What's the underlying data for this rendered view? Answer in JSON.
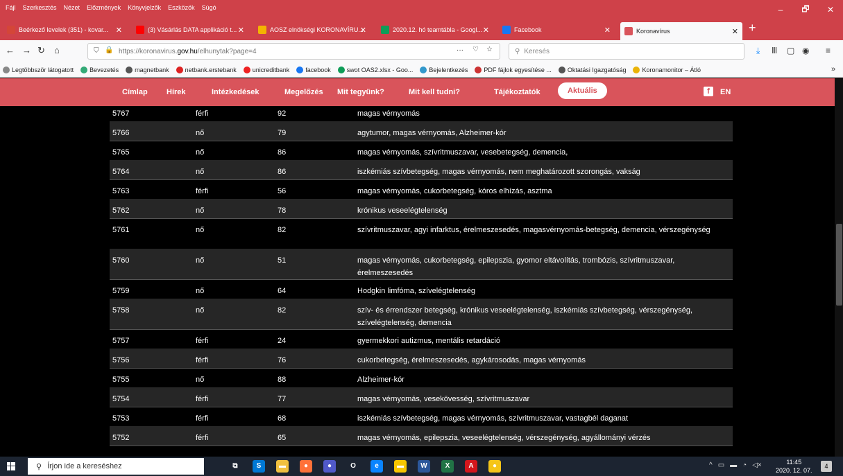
{
  "menubar": {
    "items": [
      "Fájl",
      "Szerkesztés",
      "Nézet",
      "Előzmények",
      "Könyvjelzők",
      "Eszközök",
      "Súgó"
    ]
  },
  "window": {
    "minimize": "–",
    "restore": "🗗",
    "close": "✕"
  },
  "tabs": [
    {
      "label": "Beérkező levelek (351) - kovar...",
      "icon": "gmail-icon",
      "color": "#d44638"
    },
    {
      "label": "(3) Vásárlás DATA applikáció t...",
      "icon": "youtube-icon",
      "color": "#ff0000"
    },
    {
      "label": "AOSZ elnökségi KORONAVÍRU...",
      "icon": "google-drive-icon",
      "color": "#f4b400"
    },
    {
      "label": "2020.12. hó teamtábla - Googl...",
      "icon": "google-sheets-icon",
      "color": "#0f9d58"
    },
    {
      "label": "Facebook",
      "icon": "facebook-icon",
      "color": "#1877f2"
    },
    {
      "label": "Koronavírus",
      "icon": "virus-icon",
      "color": "#d9545b",
      "active": true
    }
  ],
  "nav": {
    "url_prefix": "https://koronavirus.",
    "url_domain": "gov.hu",
    "url_suffix": "/elhunytak?page=4",
    "search_placeholder": "Keresés",
    "url_more": "···"
  },
  "bookmarks": [
    {
      "label": "Legtöbbször látogatott",
      "color": "#888"
    },
    {
      "label": "Bevezetés",
      "color": "#3a7"
    },
    {
      "label": "magnetbank",
      "color": "#555"
    },
    {
      "label": "netbank.erstebank",
      "color": "#d22"
    },
    {
      "label": "unicreditbank",
      "color": "#e22"
    },
    {
      "label": "facebook",
      "color": "#1877f2"
    },
    {
      "label": "swot OAS2.xlsx - Goo...",
      "color": "#0f9d58"
    },
    {
      "label": "Bejelentkezés",
      "color": "#39c"
    },
    {
      "label": "PDF fájlok egyesítése ...",
      "color": "#c33"
    },
    {
      "label": "Oktatási Igazgatóság",
      "color": "#555"
    },
    {
      "label": "Koronamonitor – Átló",
      "color": "#eab308"
    }
  ],
  "site_nav": {
    "items": [
      "Címlap",
      "Hírek",
      "Intézkedések",
      "Megelőzés",
      "Mit tegyünk?",
      "Mit kell tudni?",
      "Tájékoztatók",
      "Aktuális"
    ],
    "active": "Aktuális",
    "fb": "f",
    "lang": "EN"
  },
  "table": {
    "rows": [
      {
        "id": "5767",
        "sex": "férfi",
        "age": "92",
        "conditions": "magas vérnyomás"
      },
      {
        "id": "5766",
        "sex": "nő",
        "age": "79",
        "conditions": "agytumor, magas vérnyomás, Alzheimer-kór"
      },
      {
        "id": "5765",
        "sex": "nő",
        "age": "86",
        "conditions": "magas vérnyomás, szívritmuszavar, vesebetegség, demencia,"
      },
      {
        "id": "5764",
        "sex": "nő",
        "age": "86",
        "conditions": "iszkémiás szívbetegség, magas vérnyomás, nem meghatározott szorongás, vakság"
      },
      {
        "id": "5763",
        "sex": "férfi",
        "age": "56",
        "conditions": "magas vérnyomás, cukorbetegség, kóros elhízás, asztma"
      },
      {
        "id": "5762",
        "sex": "nő",
        "age": "78",
        "conditions": "krónikus veseelégtelenség"
      },
      {
        "id": "5761",
        "sex": "nő",
        "age": "82",
        "conditions": "szívritmuszavar, agyi infarktus, érelmeszesedés, magasvérnyomás-betegség, demencia, vérszegénység"
      },
      {
        "id": "5760",
        "sex": "nő",
        "age": "51",
        "conditions": "magas vérnyomás, cukorbetegség, epilepszia, gyomor eltávolítás, trombózis, szívritmuszavar, érelmeszesedés"
      },
      {
        "id": "5759",
        "sex": "nő",
        "age": "64",
        "conditions": "Hodgkin limfóma, szívelégtelenség"
      },
      {
        "id": "5758",
        "sex": "nő",
        "age": "82",
        "conditions": "szív- és érrendszer betegség, krónikus veseelégtelenség, iszkémiás szívbetegség, vérszegénység, szívelégtelenség, demencia"
      },
      {
        "id": "5757",
        "sex": "férfi",
        "age": "24",
        "conditions": "gyermekkori autizmus, mentális retardáció"
      },
      {
        "id": "5756",
        "sex": "férfi",
        "age": "76",
        "conditions": "cukorbetegség, érelmeszesedés, agykárosodás, magas vérnyomás"
      },
      {
        "id": "5755",
        "sex": "nő",
        "age": "88",
        "conditions": "Alzheimer-kór"
      },
      {
        "id": "5754",
        "sex": "férfi",
        "age": "77",
        "conditions": "magas vérnyomás, vesekövesség, szívritmuszavar"
      },
      {
        "id": "5753",
        "sex": "férfi",
        "age": "68",
        "conditions": "iszkémiás szívbetegség, magas vérnyomás, szívritmuszavar, vastagbél daganat"
      },
      {
        "id": "5752",
        "sex": "férfi",
        "age": "65",
        "conditions": "magas vérnyomás, epilepszia, veseelégtelenség, vérszegénység, agyállományi vérzés"
      }
    ]
  },
  "taskbar": {
    "search_placeholder": "Írjon ide a kereséshez",
    "apps": [
      {
        "icon": "task-view-icon",
        "label": "⧉",
        "color": "#1c2431"
      },
      {
        "icon": "skype-icon",
        "label": "S",
        "color": "#0078d4"
      },
      {
        "icon": "file-explorer-icon",
        "label": "▬",
        "color": "#f0c040"
      },
      {
        "icon": "firefox-icon",
        "label": "●",
        "color": "#ff7139"
      },
      {
        "icon": "teams-icon",
        "label": "●",
        "color": "#5059c9"
      },
      {
        "icon": "opera-icon",
        "label": "O",
        "color": "#1c2431"
      },
      {
        "icon": "edge-icon",
        "label": "e",
        "color": "#0a84ff"
      },
      {
        "icon": "sticky-notes-icon",
        "label": "▬",
        "color": "#f7c600"
      },
      {
        "icon": "word-icon",
        "label": "W",
        "color": "#2b579a"
      },
      {
        "icon": "excel-icon",
        "label": "X",
        "color": "#217346"
      },
      {
        "icon": "acrobat-icon",
        "label": "A",
        "color": "#d4161c"
      },
      {
        "icon": "chrome-like-icon",
        "label": "●",
        "color": "#f5c518"
      }
    ],
    "time": "11:45",
    "date": "2020. 12. 07.",
    "notifications": "4"
  }
}
